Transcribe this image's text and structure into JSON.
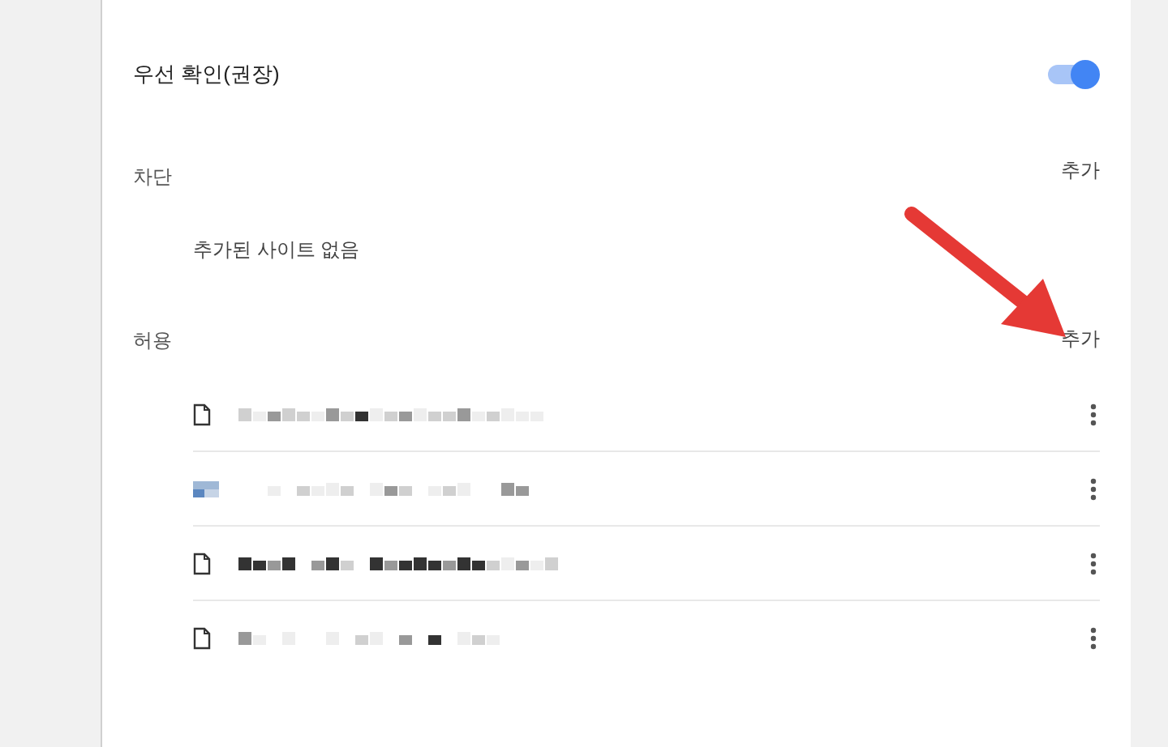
{
  "setting": {
    "label": "우선 확인(권장)",
    "on": true
  },
  "block": {
    "title": "차단",
    "add": "추가",
    "empty": "추가된 사이트 없음"
  },
  "allow": {
    "title": "허용",
    "add": "추가",
    "sites": [
      {
        "kind": "file"
      },
      {
        "kind": "favicon"
      },
      {
        "kind": "file"
      },
      {
        "kind": "file"
      }
    ]
  },
  "annotations": [
    {
      "kind": "arrow",
      "color": "#e53935"
    }
  ]
}
